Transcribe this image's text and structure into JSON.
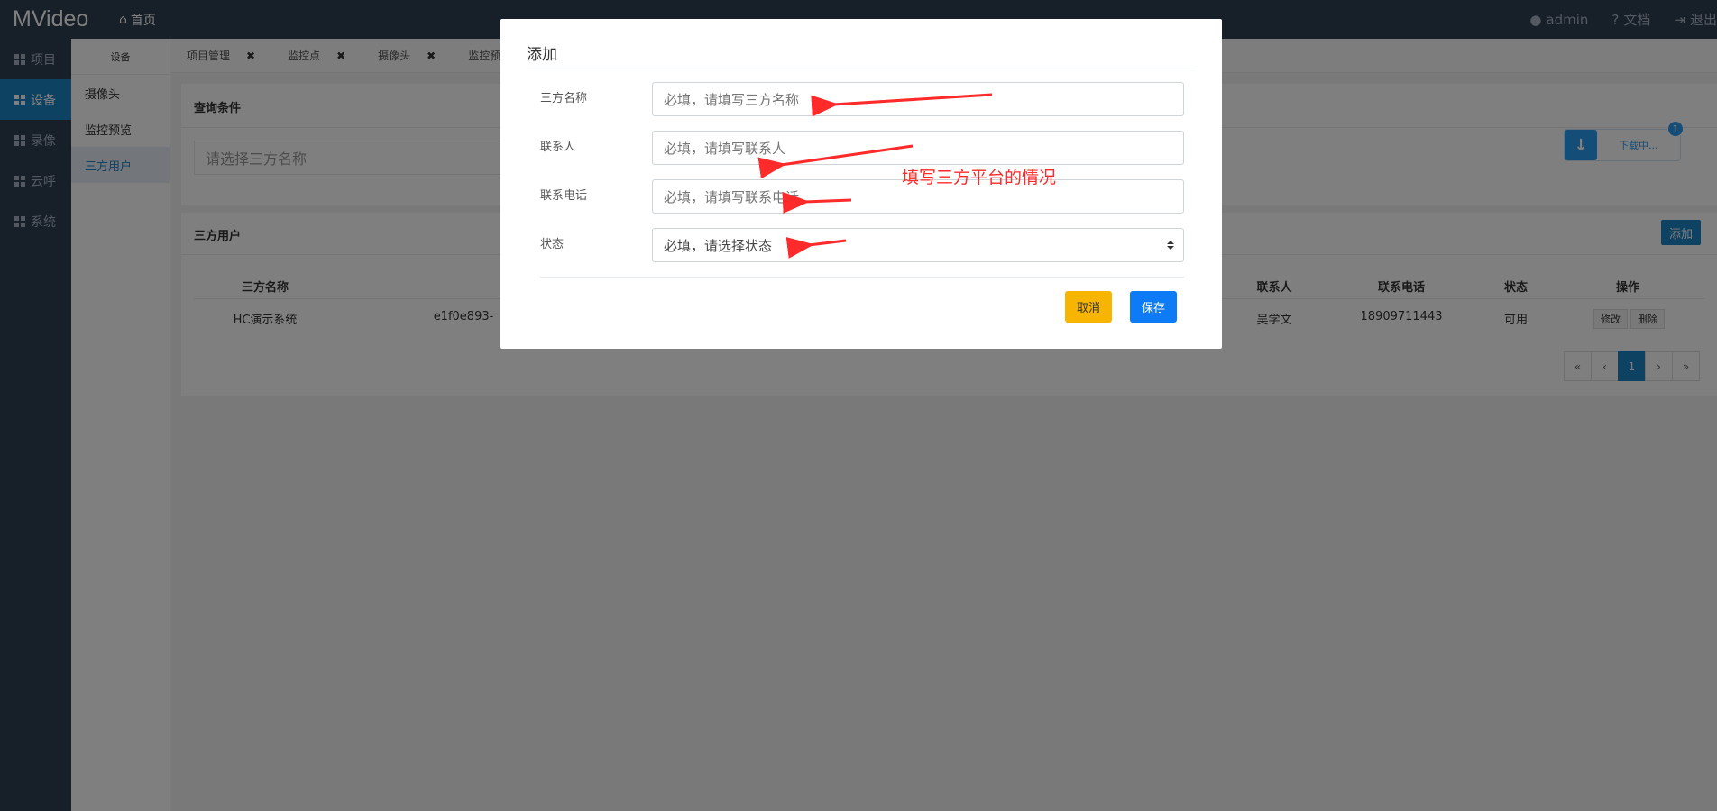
{
  "topbar": {
    "brand": "MVideo",
    "home_label": "首页",
    "user_label": "admin",
    "docs_label": "文档",
    "logout_label": "退出"
  },
  "sidebar": {
    "items": [
      {
        "label": "项目"
      },
      {
        "label": "设备"
      },
      {
        "label": "录像"
      },
      {
        "label": "云呼"
      },
      {
        "label": "系统"
      }
    ]
  },
  "subnav": {
    "header": "设备",
    "items": [
      {
        "label": "摄像头"
      },
      {
        "label": "监控预览"
      },
      {
        "label": "三方用户"
      }
    ]
  },
  "tabs": [
    {
      "label": "项目管理",
      "close": "✖"
    },
    {
      "label": "监控点",
      "close": "✖"
    },
    {
      "label": "摄像头",
      "close": "✖"
    },
    {
      "label": "监控预览",
      "close": ""
    }
  ],
  "query": {
    "title": "查询条件",
    "placeholder": "请选择三方名称"
  },
  "list": {
    "title": "三方用户",
    "add_label": "添加",
    "columns": [
      "三方名称",
      "联系人",
      "联系电话",
      "状态",
      "操作"
    ],
    "rows": [
      {
        "name": "HC演示系统",
        "id_prefix": "e1f0e893-",
        "contact": "吴学文",
        "phone": "18909711443",
        "status": "可用",
        "edit": "修改",
        "delete": "删除"
      }
    ],
    "pager": [
      "«",
      "‹",
      "1",
      "›",
      "»"
    ]
  },
  "download": {
    "label": "下载中...",
    "badge": "1"
  },
  "modal": {
    "title": "添加",
    "fields": [
      {
        "label": "三方名称",
        "placeholder": "必填，请填写三方名称"
      },
      {
        "label": "联系人",
        "placeholder": "必填，请填写联系人"
      },
      {
        "label": "联系电话",
        "placeholder": "必填，请填写联系电话"
      },
      {
        "label": "状态",
        "placeholder": "必填，请选择状态"
      }
    ],
    "cancel_label": "取消",
    "save_label": "保存"
  },
  "annotation": {
    "text": "填写三方平台的情况",
    "color": "#ff2a2a"
  }
}
